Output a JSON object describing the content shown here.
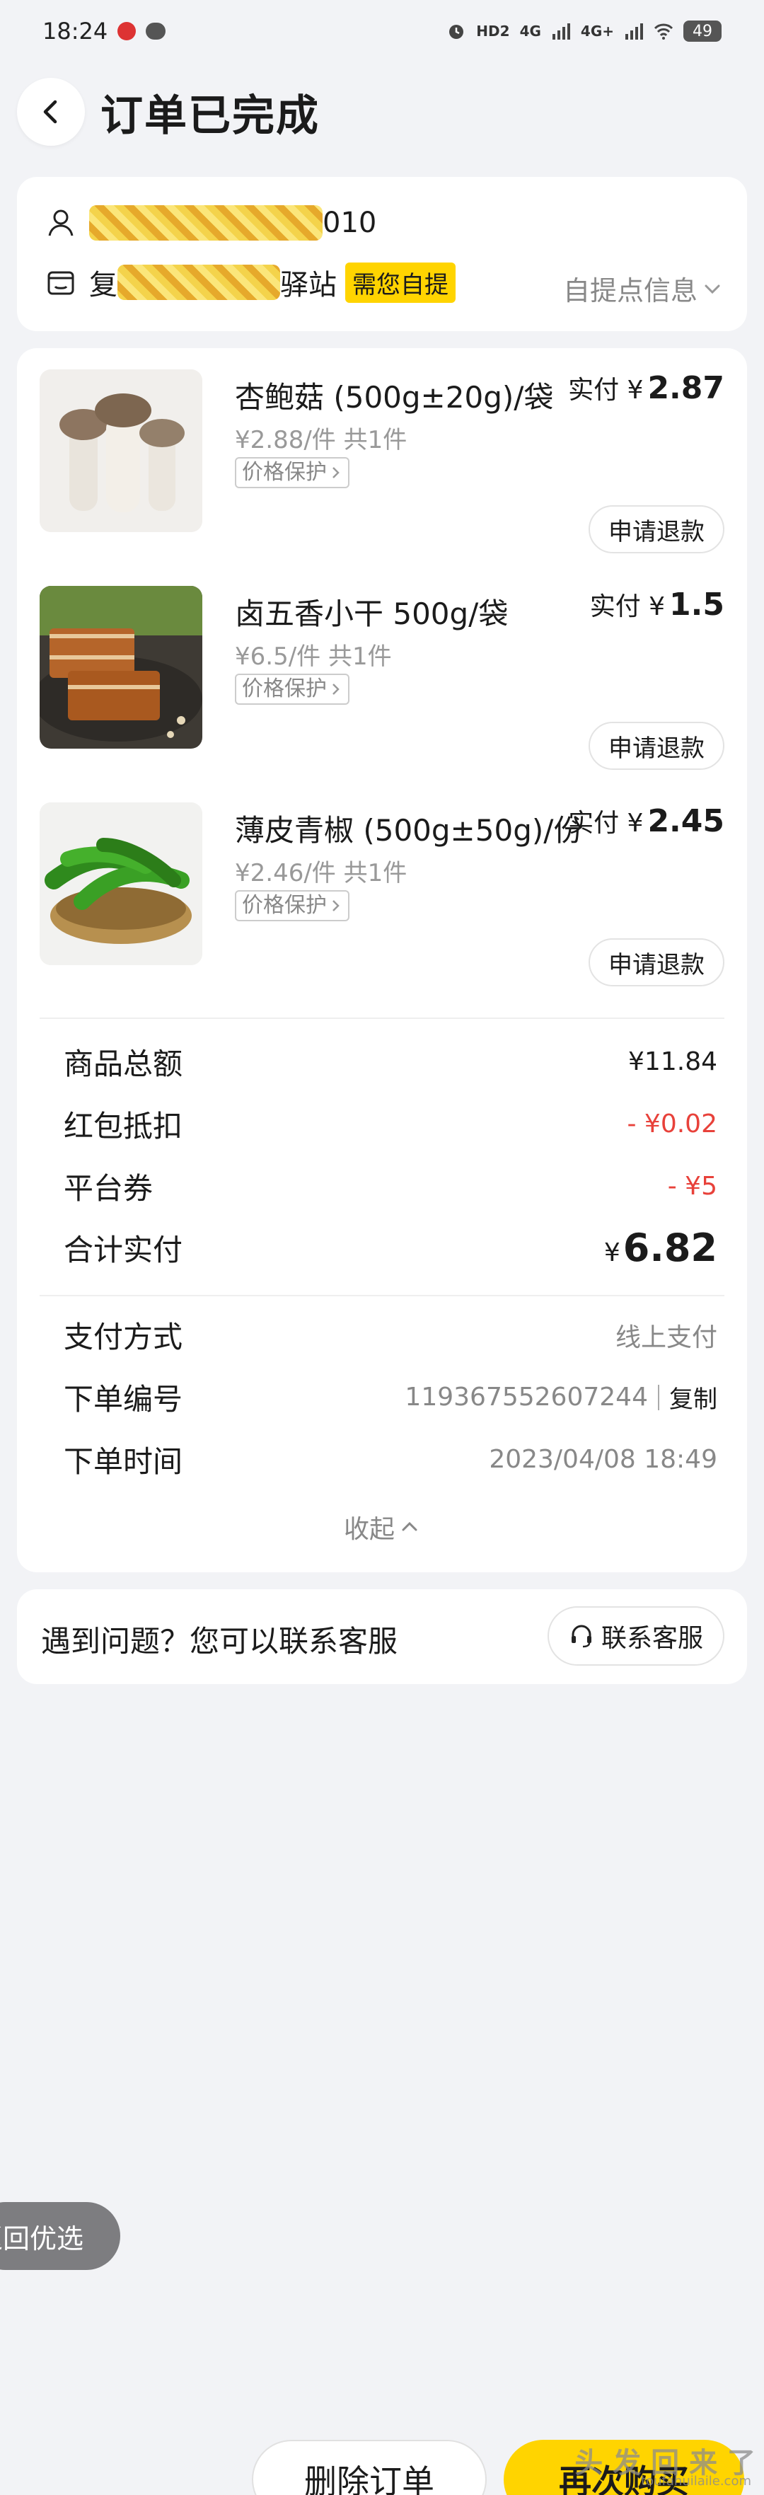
{
  "status_bar": {
    "time": "18:24",
    "network_1": "4G",
    "network_2": "4G+",
    "hd": "HD2",
    "battery": "49"
  },
  "header": {
    "title": "订单已完成"
  },
  "pickup": {
    "phone_suffix": "010",
    "station_suffix": "驿站",
    "station_prefix": "复",
    "self_pickup_tag": "需您自提",
    "info_label": "自提点信息"
  },
  "products": [
    {
      "name": "杏鲍菇 (500g±20g)/袋",
      "paid_label": "实付 ¥",
      "paid_amount": "2.87",
      "unit_price": "¥2.88/件  共1件",
      "guard_label": "价格保护",
      "refund_label": "申请退款",
      "image": "king-oyster-mushroom"
    },
    {
      "name": "卤五香小干 500g/袋",
      "paid_label": "实付 ¥",
      "paid_amount": "1.5",
      "unit_price": "¥6.5/件  共1件",
      "guard_label": "价格保护",
      "refund_label": "申请退款",
      "image": "spiced-tofu"
    },
    {
      "name": "薄皮青椒 (500g±50g)/份",
      "paid_label": "实付 ¥",
      "paid_amount": "2.45",
      "unit_price": "¥2.46/件  共1件",
      "guard_label": "价格保护",
      "refund_label": "申请退款",
      "image": "green-pepper"
    }
  ],
  "summary": {
    "goods_total_label": "商品总额",
    "goods_total": "¥11.84",
    "redpacket_label": "红包抵扣",
    "redpacket": "- ¥0.02",
    "coupon_label": "平台券",
    "coupon": "- ¥5",
    "paid_label": "合计实付",
    "paid_currency": "¥",
    "paid": "6.82"
  },
  "order_info": {
    "pay_method_label": "支付方式",
    "pay_method": "线上支付",
    "order_no_label": "下单编号",
    "order_no": "119367552607244",
    "copy_label": "复制",
    "order_time_label": "下单时间",
    "order_time": "2023/04/08 18:49",
    "collapse_label": "收起"
  },
  "help": {
    "text": "遇到问题？您可以联系客服",
    "button": "联系客服"
  },
  "float_pill": {
    "label": "返回优选"
  },
  "bottom": {
    "delete_label": "删除订单",
    "rebuy_label": "再次购买"
  },
  "watermark": {
    "text": "头 发 回 来 了",
    "url": "toufahuilaile.com"
  },
  "colors": {
    "accent_yellow": "#ffd400",
    "discount_red": "#e8413a",
    "background": "#f2f3f6"
  }
}
